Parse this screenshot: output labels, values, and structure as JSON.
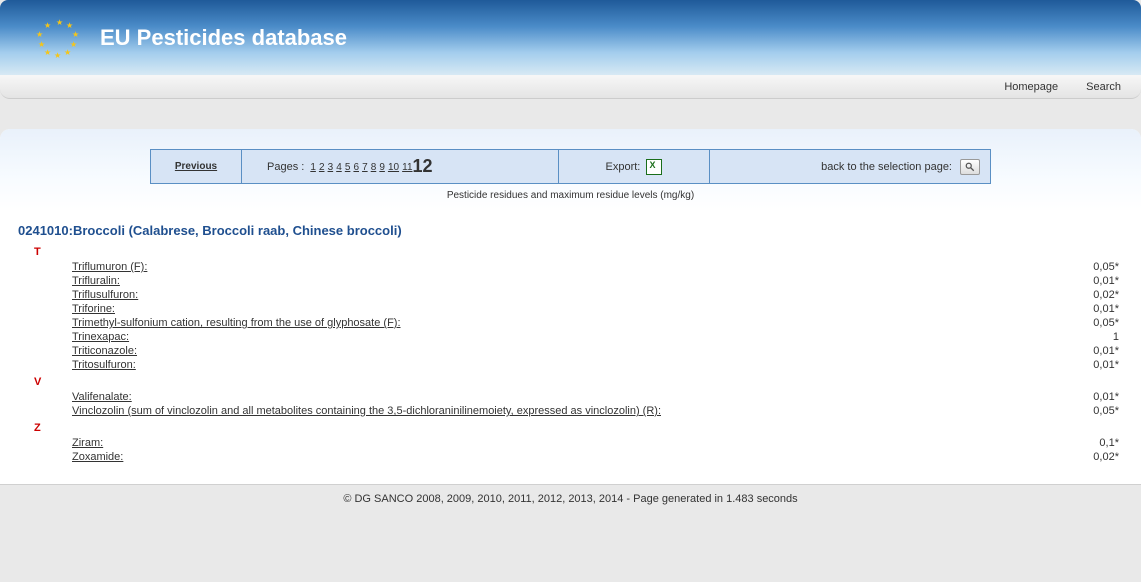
{
  "header": {
    "title": "EU Pesticides database"
  },
  "nav": {
    "homepage": "Homepage",
    "search": "Search"
  },
  "toolbar": {
    "previous": "Previous",
    "pages_label": "Pages :",
    "pages": [
      "1",
      "2",
      "3",
      "4",
      "5",
      "6",
      "7",
      "8",
      "9",
      "10",
      "11"
    ],
    "current_page": "12",
    "export_label": "Export:",
    "back_label": "back to the selection page:"
  },
  "subtitle": "Pesticide residues and maximum residue levels (mg/kg)",
  "product": "0241010:Broccoli (Calabrese, Broccoli raab, Chinese broccoli)",
  "groups": [
    {
      "letter": "T",
      "rows": [
        {
          "name": "Triflumuron (F):",
          "value": "0,05*"
        },
        {
          "name": "Trifluralin:",
          "value": "0,01*"
        },
        {
          "name": "Triflusulfuron:",
          "value": "0,02*"
        },
        {
          "name": "Triforine:",
          "value": "0,01*"
        },
        {
          "name": "Trimethyl-sulfonium cation, resulting from the use of glyphosate (F):",
          "value": "0,05*"
        },
        {
          "name": "Trinexapac:",
          "value": "1"
        },
        {
          "name": "Triticonazole:",
          "value": "0,01*"
        },
        {
          "name": "Tritosulfuron:",
          "value": "0,01*"
        }
      ]
    },
    {
      "letter": "V",
      "rows": [
        {
          "name": "Valifenalate:",
          "value": "0,01*"
        },
        {
          "name": "Vinclozolin (sum of vinclozolin and all metabolites containing the 3,5-dichloraninilinemoiety, expressed as vinclozolin) (R):",
          "value": "0,05*"
        }
      ]
    },
    {
      "letter": "Z",
      "rows": [
        {
          "name": "Ziram:",
          "value": "0,1*"
        },
        {
          "name": "Zoxamide:",
          "value": "0,02*"
        }
      ]
    }
  ],
  "footer": "© DG SANCO 2008, 2009, 2010, 2011, 2012, 2013, 2014 - Page generated in 1.483 seconds"
}
